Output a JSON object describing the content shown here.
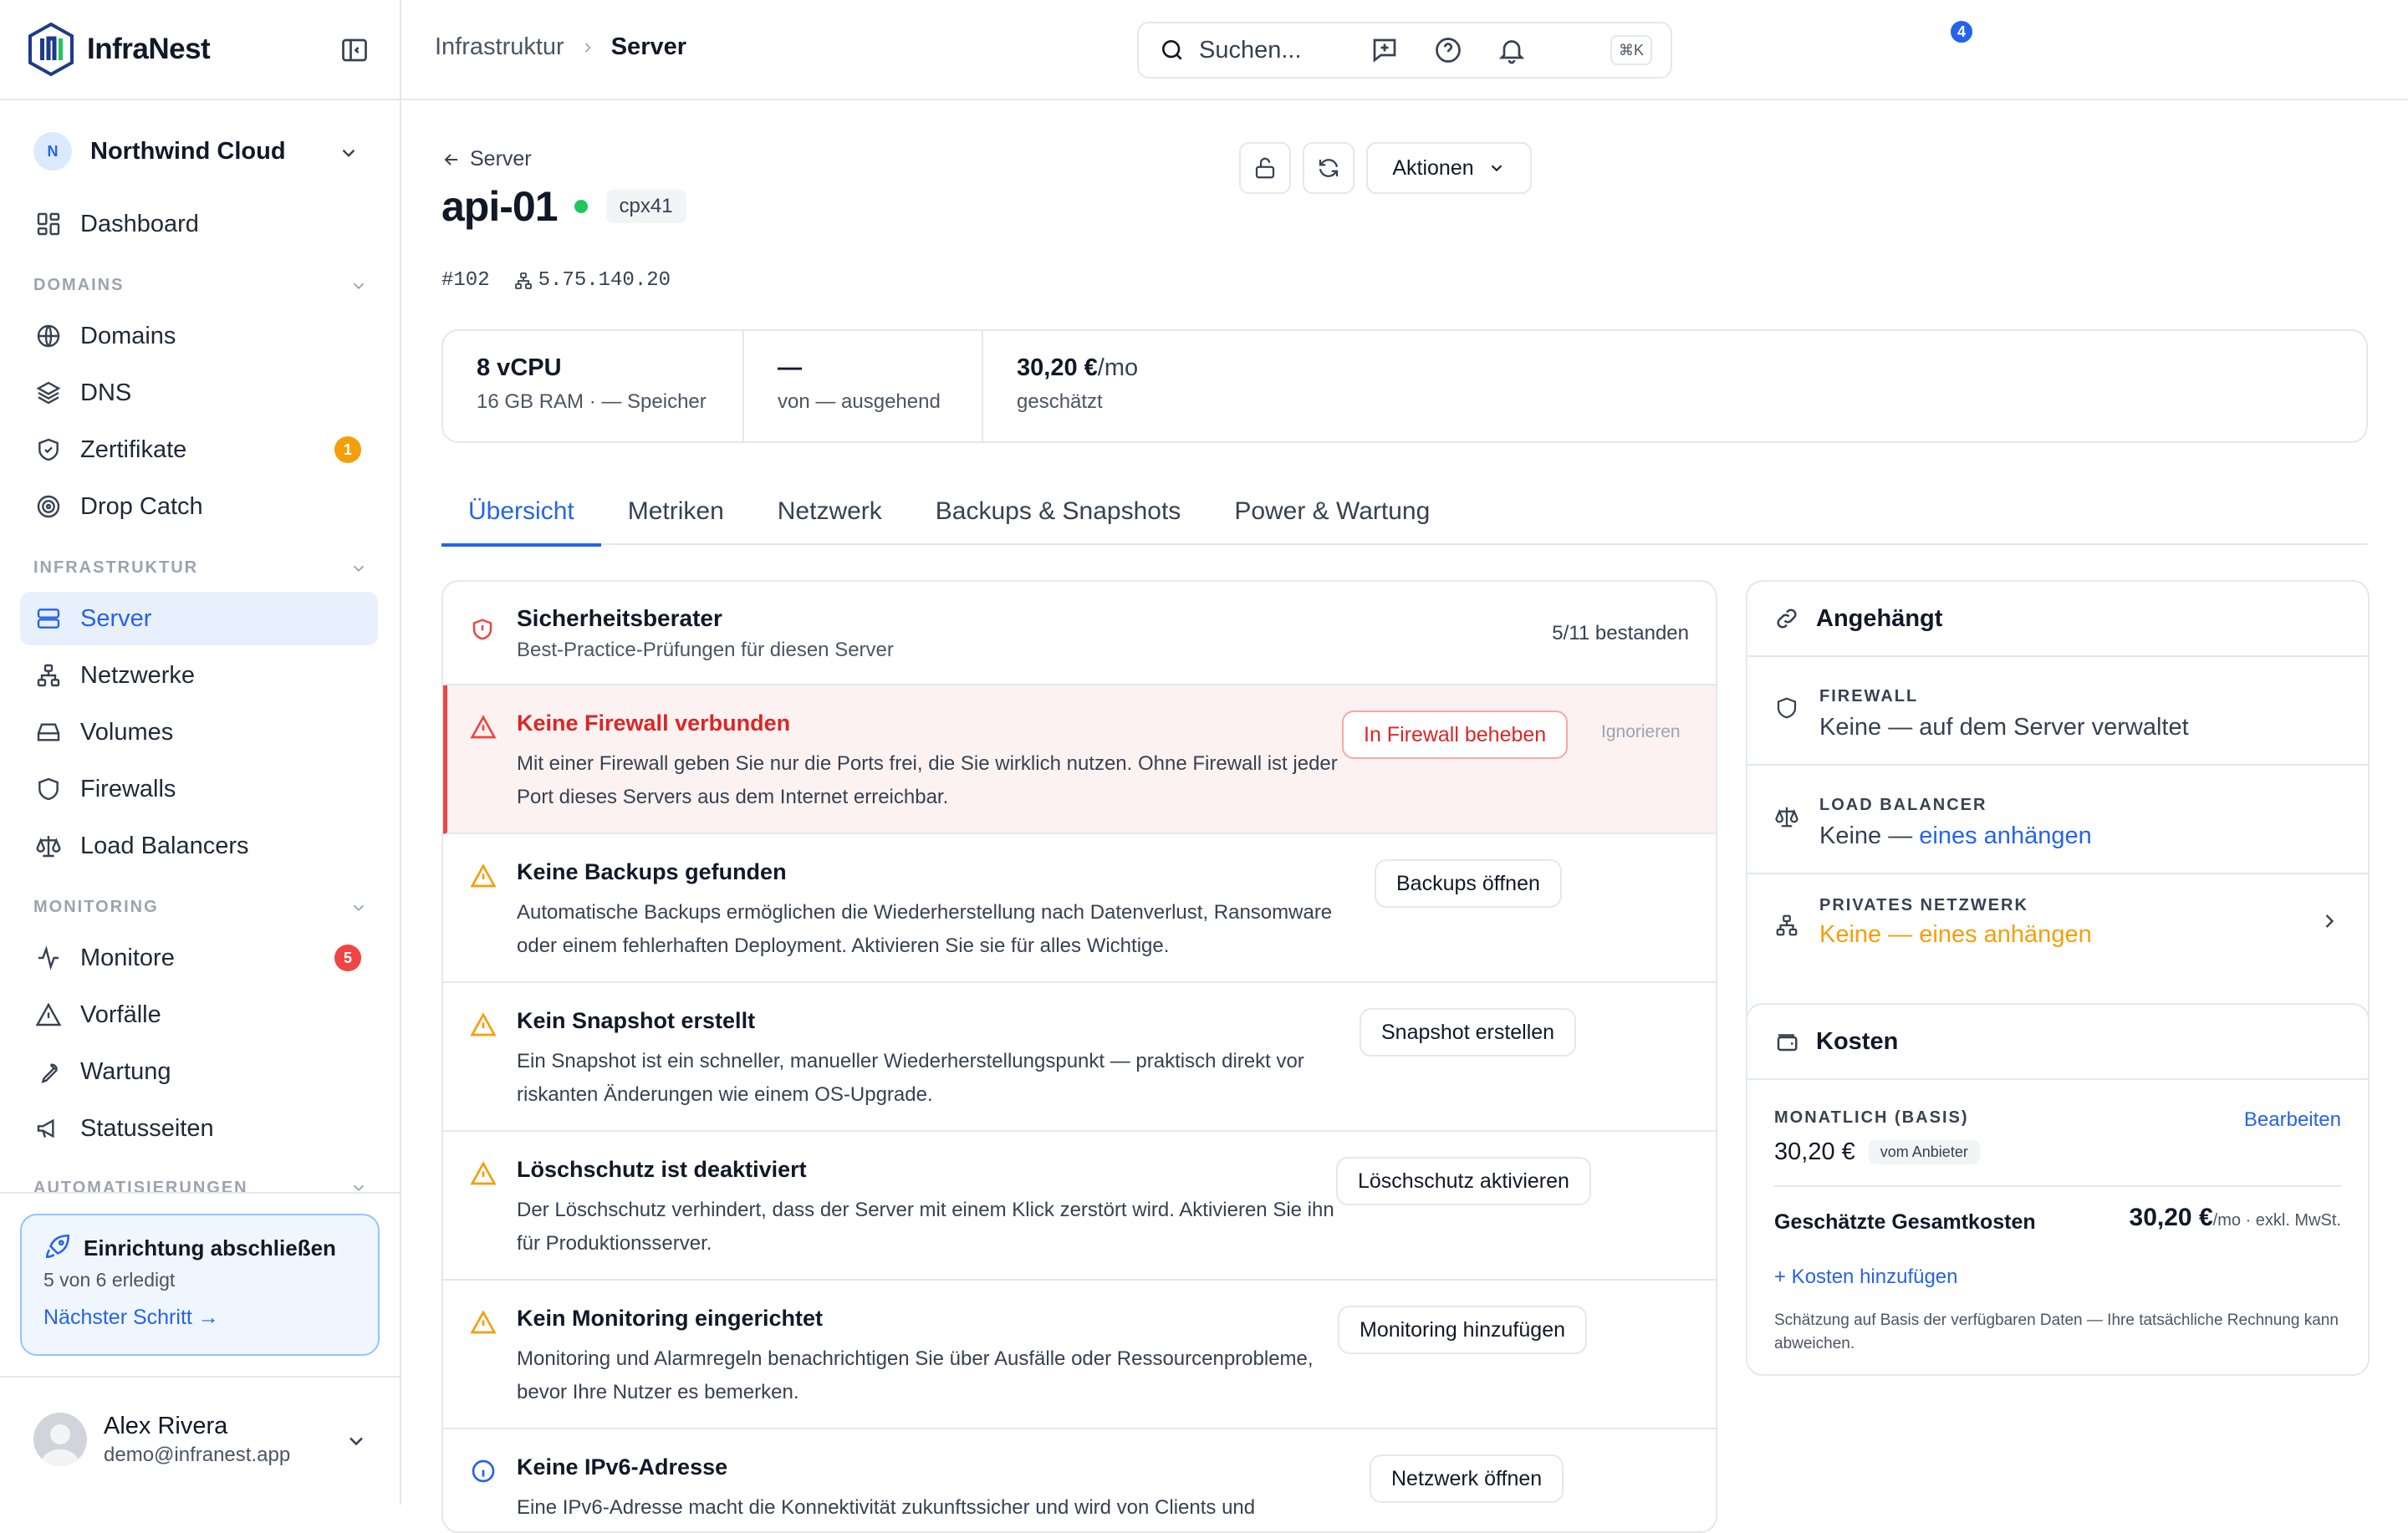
{
  "app": {
    "name": "InfraNest"
  },
  "org": {
    "initial": "N",
    "name": "Northwind Cloud"
  },
  "nav": {
    "dashboard": "Dashboard",
    "sections": {
      "domains": "DOMAINS",
      "infra": "INFRASTRUKTUR",
      "monitoring": "MONITORING",
      "automation": "AUTOMATISIERUNGEN"
    },
    "domains": "Domains",
    "dns": "DNS",
    "certs": "Zertifikate",
    "certs_badge": "1",
    "dropcatch": "Drop Catch",
    "server": "Server",
    "networks": "Netzwerke",
    "volumes": "Volumes",
    "firewalls": "Firewalls",
    "lb": "Load Balancers",
    "monitors": "Monitore",
    "monitors_badge": "5",
    "incidents": "Vorfälle",
    "maintenance": "Wartung",
    "status": "Statusseiten"
  },
  "setup": {
    "title": "Einrichtung abschließen",
    "progress": "5 von 6 erledigt",
    "next": "Nächster Schritt →"
  },
  "user": {
    "name": "Alex Rivera",
    "email": "demo@infranest.app"
  },
  "topbar": {
    "crumb_parent": "Infrastruktur",
    "crumb_current": "Server",
    "search_placeholder": "Suchen...",
    "shortcut": "⌘K",
    "notifications": "4"
  },
  "server": {
    "back": "Server",
    "name": "api-01",
    "type": "cpx41",
    "id": "#102",
    "ip": "5.75.140.20",
    "actions": "Aktionen"
  },
  "stats": [
    {
      "value": "8 vCPU",
      "sub": "16 GB RAM · — Speicher"
    },
    {
      "value": "—",
      "sub": "von — ausgehend"
    },
    {
      "value": "30,20 €",
      "unit": "/mo",
      "sub": "geschätzt"
    }
  ],
  "tabs": [
    "Übersicht",
    "Metriken",
    "Netzwerk",
    "Backups & Snapshots",
    "Power & Wartung"
  ],
  "advisor": {
    "title": "Sicherheitsberater",
    "subtitle": "Best-Practice-Prüfungen für diesen Server",
    "count": "5/11 bestanden",
    "items": [
      {
        "title": "Keine Firewall verbunden",
        "desc": "Mit einer Firewall geben Sie nur die Ports frei, die Sie wirklich nutzen. Ohne Firewall ist jeder Port dieses Servers aus dem Internet erreichbar.",
        "action": "In Firewall beheben",
        "ignore": "Ignorieren"
      },
      {
        "title": "Keine Backups gefunden",
        "desc": "Automatische Backups ermöglichen die Wiederherstellung nach Datenverlust, Ransomware oder einem fehlerhaften Deployment. Aktivieren Sie sie für alles Wichtige.",
        "action": "Backups öffnen"
      },
      {
        "title": "Kein Snapshot erstellt",
        "desc": "Ein Snapshot ist ein schneller, manueller Wiederherstellungspunkt — praktisch direkt vor riskanten Änderungen wie einem OS-Upgrade.",
        "action": "Snapshot erstellen"
      },
      {
        "title": "Löschschutz ist deaktiviert",
        "desc": "Der Löschschutz verhindert, dass der Server mit einem Klick zerstört wird. Aktivieren Sie ihn für Produktionsserver.",
        "action": "Löschschutz aktivieren"
      },
      {
        "title": "Kein Monitoring eingerichtet",
        "desc": "Monitoring und Alarmregeln benachrichtigen Sie über Ausfälle oder Ressourcenprobleme, bevor Ihre Nutzer es bemerken.",
        "action": "Monitoring hinzufügen"
      },
      {
        "title": "Keine IPv6-Adresse",
        "desc": "Eine IPv6-Adresse macht die Konnektivität zukunftssicher und wird von Clients und",
        "action": "Netzwerk öffnen"
      }
    ]
  },
  "attached": {
    "title": "Angehängt",
    "firewall": {
      "key": "FIREWALL",
      "value": "Keine — auf dem Server verwaltet"
    },
    "lb": {
      "key": "LOAD BALANCER",
      "value": "Keine — ",
      "link": "eines anhängen"
    },
    "net": {
      "key": "PRIVATES NETZWERK",
      "value": "Keine — eines anhängen"
    }
  },
  "costs": {
    "title": "Kosten",
    "monthly_label": "MONATLICH (BASIS)",
    "edit": "Bearbeiten",
    "monthly_value": "30,20 €",
    "source": "vom Anbieter",
    "total_label": "Geschätzte Gesamtkosten",
    "total_value": "30,20 €",
    "total_unit": "/mo · exkl. MwSt.",
    "add": "+ Kosten hinzufügen",
    "note": "Schätzung auf Basis der verfügbaren Daten — Ihre tatsächliche Rechnung kann abweichen."
  },
  "colors": {
    "accent": "#2563eb",
    "success": "#22c55e",
    "danger": "#ef4444",
    "warning": "#f59e0b",
    "badge_orange": "#f59e0b",
    "badge_red": "#ef4444"
  }
}
